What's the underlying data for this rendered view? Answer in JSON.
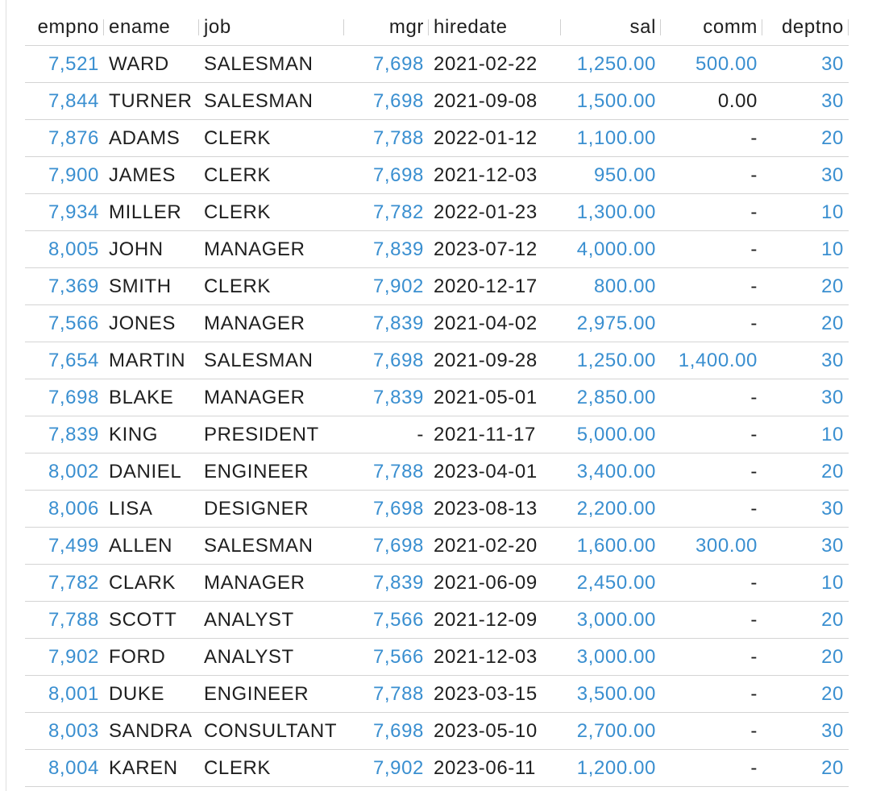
{
  "columns": {
    "empno": "empno",
    "ename": "ename",
    "job": "job",
    "mgr": "mgr",
    "hiredate": "hiredate",
    "sal": "sal",
    "comm": "comm",
    "deptno": "deptno"
  },
  "colors": {
    "number_link": "#3a8fd0",
    "text": "#1f1f1f",
    "grid": "#d4d4d4"
  },
  "rows": [
    {
      "empno": "7,521",
      "ename": "WARD",
      "job": "SALESMAN",
      "mgr": "7,698",
      "hiredate": "2021-02-22",
      "sal": "1,250.00",
      "comm": "500.00",
      "deptno": "30"
    },
    {
      "empno": "7,844",
      "ename": "TURNER",
      "job": "SALESMAN",
      "mgr": "7,698",
      "hiredate": "2021-09-08",
      "sal": "1,500.00",
      "comm": "0.00",
      "deptno": "30"
    },
    {
      "empno": "7,876",
      "ename": "ADAMS",
      "job": "CLERK",
      "mgr": "7,788",
      "hiredate": "2022-01-12",
      "sal": "1,100.00",
      "comm": "-",
      "deptno": "20"
    },
    {
      "empno": "7,900",
      "ename": "JAMES",
      "job": "CLERK",
      "mgr": "7,698",
      "hiredate": "2021-12-03",
      "sal": "950.00",
      "comm": "-",
      "deptno": "30"
    },
    {
      "empno": "7,934",
      "ename": "MILLER",
      "job": "CLERK",
      "mgr": "7,782",
      "hiredate": "2022-01-23",
      "sal": "1,300.00",
      "comm": "-",
      "deptno": "10"
    },
    {
      "empno": "8,005",
      "ename": "JOHN",
      "job": "MANAGER",
      "mgr": "7,839",
      "hiredate": "2023-07-12",
      "sal": "4,000.00",
      "comm": "-",
      "deptno": "10"
    },
    {
      "empno": "7,369",
      "ename": "SMITH",
      "job": "CLERK",
      "mgr": "7,902",
      "hiredate": "2020-12-17",
      "sal": "800.00",
      "comm": "-",
      "deptno": "20"
    },
    {
      "empno": "7,566",
      "ename": "JONES",
      "job": "MANAGER",
      "mgr": "7,839",
      "hiredate": "2021-04-02",
      "sal": "2,975.00",
      "comm": "-",
      "deptno": "20"
    },
    {
      "empno": "7,654",
      "ename": "MARTIN",
      "job": "SALESMAN",
      "mgr": "7,698",
      "hiredate": "2021-09-28",
      "sal": "1,250.00",
      "comm": "1,400.00",
      "deptno": "30"
    },
    {
      "empno": "7,698",
      "ename": "BLAKE",
      "job": "MANAGER",
      "mgr": "7,839",
      "hiredate": "2021-05-01",
      "sal": "2,850.00",
      "comm": "-",
      "deptno": "30"
    },
    {
      "empno": "7,839",
      "ename": "KING",
      "job": "PRESIDENT",
      "mgr": "-",
      "hiredate": "2021-11-17",
      "sal": "5,000.00",
      "comm": "-",
      "deptno": "10"
    },
    {
      "empno": "8,002",
      "ename": "DANIEL",
      "job": "ENGINEER",
      "mgr": "7,788",
      "hiredate": "2023-04-01",
      "sal": "3,400.00",
      "comm": "-",
      "deptno": "20"
    },
    {
      "empno": "8,006",
      "ename": "LISA",
      "job": "DESIGNER",
      "mgr": "7,698",
      "hiredate": "2023-08-13",
      "sal": "2,200.00",
      "comm": "-",
      "deptno": "30"
    },
    {
      "empno": "7,499",
      "ename": "ALLEN",
      "job": "SALESMAN",
      "mgr": "7,698",
      "hiredate": "2021-02-20",
      "sal": "1,600.00",
      "comm": "300.00",
      "deptno": "30"
    },
    {
      "empno": "7,782",
      "ename": "CLARK",
      "job": "MANAGER",
      "mgr": "7,839",
      "hiredate": "2021-06-09",
      "sal": "2,450.00",
      "comm": "-",
      "deptno": "10"
    },
    {
      "empno": "7,788",
      "ename": "SCOTT",
      "job": "ANALYST",
      "mgr": "7,566",
      "hiredate": "2021-12-09",
      "sal": "3,000.00",
      "comm": "-",
      "deptno": "20"
    },
    {
      "empno": "7,902",
      "ename": "FORD",
      "job": "ANALYST",
      "mgr": "7,566",
      "hiredate": "2021-12-03",
      "sal": "3,000.00",
      "comm": "-",
      "deptno": "20"
    },
    {
      "empno": "8,001",
      "ename": "DUKE",
      "job": "ENGINEER",
      "mgr": "7,788",
      "hiredate": "2023-03-15",
      "sal": "3,500.00",
      "comm": "-",
      "deptno": "20"
    },
    {
      "empno": "8,003",
      "ename": "SANDRA",
      "job": "CONSULTANT",
      "mgr": "7,698",
      "hiredate": "2023-05-10",
      "sal": "2,700.00",
      "comm": "-",
      "deptno": "30"
    },
    {
      "empno": "8,004",
      "ename": "KAREN",
      "job": "CLERK",
      "mgr": "7,902",
      "hiredate": "2023-06-11",
      "sal": "1,200.00",
      "comm": "-",
      "deptno": "20"
    }
  ]
}
